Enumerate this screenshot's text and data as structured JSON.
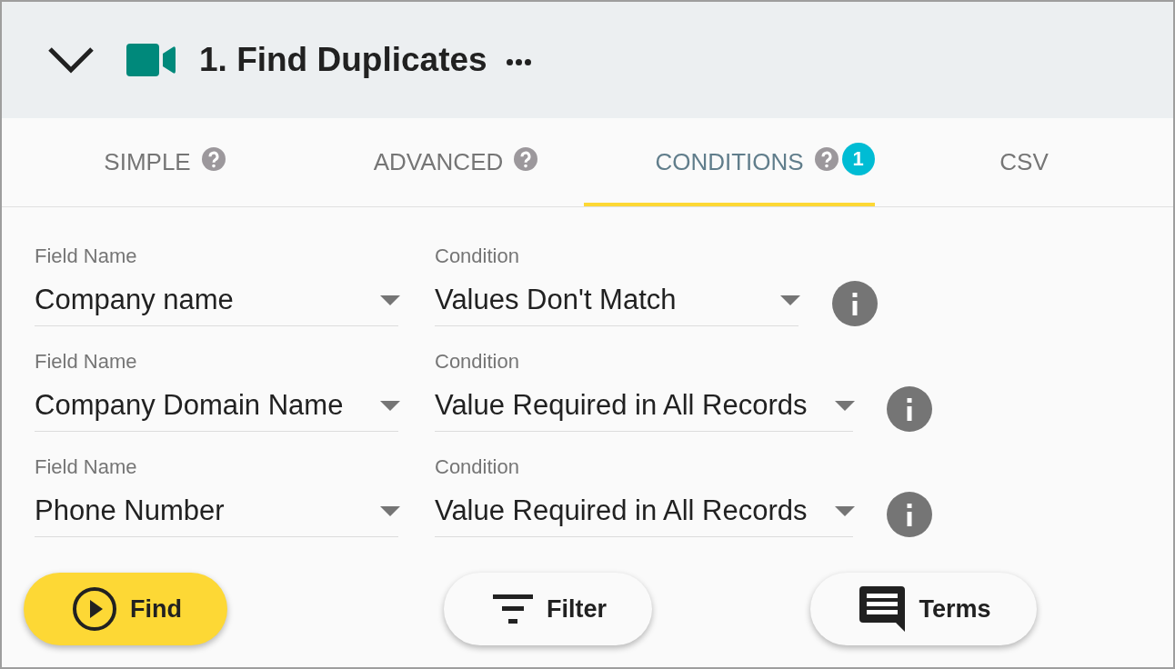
{
  "header": {
    "title": "1. Find Duplicates"
  },
  "tabs": [
    {
      "label": "SIMPLE",
      "selected": false,
      "help": true
    },
    {
      "label": "ADVANCED",
      "selected": false,
      "help": true
    },
    {
      "label": "CONDITIONS",
      "selected": true,
      "help": true,
      "badge": "1"
    },
    {
      "label": "CSV",
      "selected": false,
      "help": false
    }
  ],
  "conditions": [
    {
      "field_label": "Field Name",
      "field": "Company name",
      "condition_label": "Condition",
      "condition": "Values Don't Match"
    },
    {
      "field_label": "Field Name",
      "field": "Company Domain Name",
      "condition_label": "Condition",
      "condition": "Value Required in All Records"
    },
    {
      "field_label": "Field Name",
      "field": "Phone Number",
      "condition_label": "Condition",
      "condition": "Value Required in All Records"
    }
  ],
  "buttons": [
    {
      "kind": "primary",
      "label": "Find"
    },
    {
      "kind": "filter",
      "label": "Filter"
    },
    {
      "kind": "terms",
      "label": "Terms"
    }
  ]
}
